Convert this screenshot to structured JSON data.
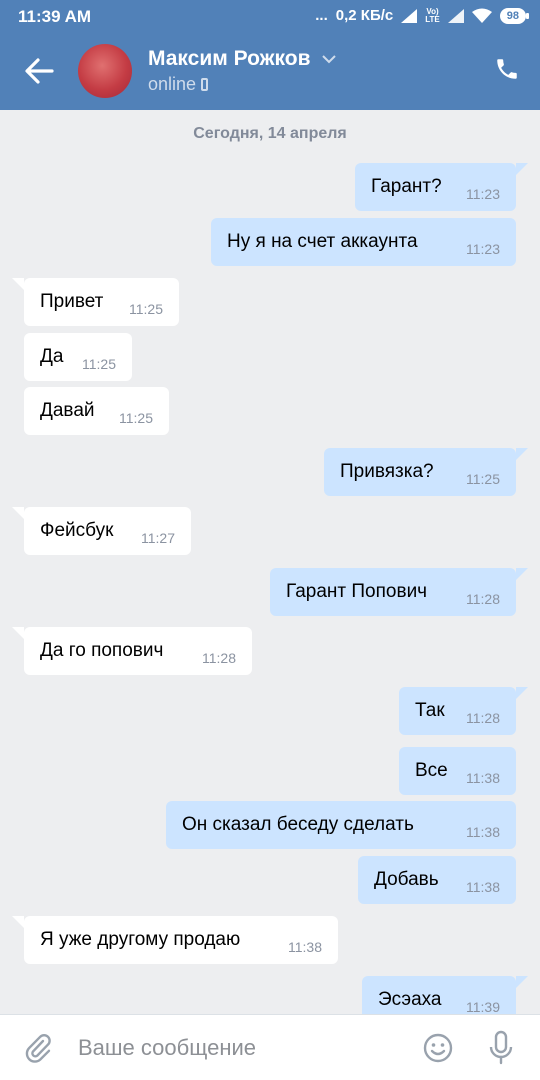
{
  "status_bar": {
    "time": "11:39 AM",
    "dots": "...",
    "speed": "0,2 КБ/с",
    "network": "Vo) LTE",
    "battery": "98"
  },
  "header": {
    "name": "Максим Рожков",
    "presence": "online"
  },
  "chat": {
    "date": "Сегодня, 14 апреля",
    "messages": [
      {
        "dir": "out",
        "text": "Гарант?",
        "time": "11:23"
      },
      {
        "dir": "out",
        "text": "Ну я на счет аккаунта",
        "time": "11:23"
      },
      {
        "dir": "in",
        "text": "Привет",
        "time": "11:25"
      },
      {
        "dir": "in",
        "text": "Да",
        "time": "11:25"
      },
      {
        "dir": "in",
        "text": "Давай",
        "time": "11:25"
      },
      {
        "dir": "out",
        "text": "Привязка?",
        "time": "11:25"
      },
      {
        "dir": "in",
        "text": "Фейсбук",
        "time": "11:27"
      },
      {
        "dir": "out",
        "text": "Гарант Попович",
        "time": "11:28"
      },
      {
        "dir": "in",
        "text": "Да го попович",
        "time": "11:28"
      },
      {
        "dir": "out",
        "text": "Так",
        "time": "11:28"
      },
      {
        "dir": "out",
        "text": "Все",
        "time": "11:38"
      },
      {
        "dir": "out",
        "text": "Он сказал беседу сделать",
        "time": "11:38"
      },
      {
        "dir": "out",
        "text": "Добавь",
        "time": "11:38"
      },
      {
        "dir": "in",
        "text": "Я уже другому продаю",
        "time": "11:38"
      },
      {
        "dir": "out",
        "text": "Эсэаха",
        "time": "11:39"
      }
    ]
  },
  "composer": {
    "placeholder": "Ваше сообщение"
  },
  "colors": {
    "header_bg": "#5181b8",
    "chat_bg": "#edeef0",
    "outgoing_bubble": "#cce4ff",
    "incoming_bubble": "#ffffff"
  },
  "icons": [
    "back-arrow-icon",
    "chevron-down-icon",
    "phone-device-icon",
    "phone-call-icon",
    "paperclip-icon",
    "emoji-icon",
    "microphone-icon"
  ]
}
